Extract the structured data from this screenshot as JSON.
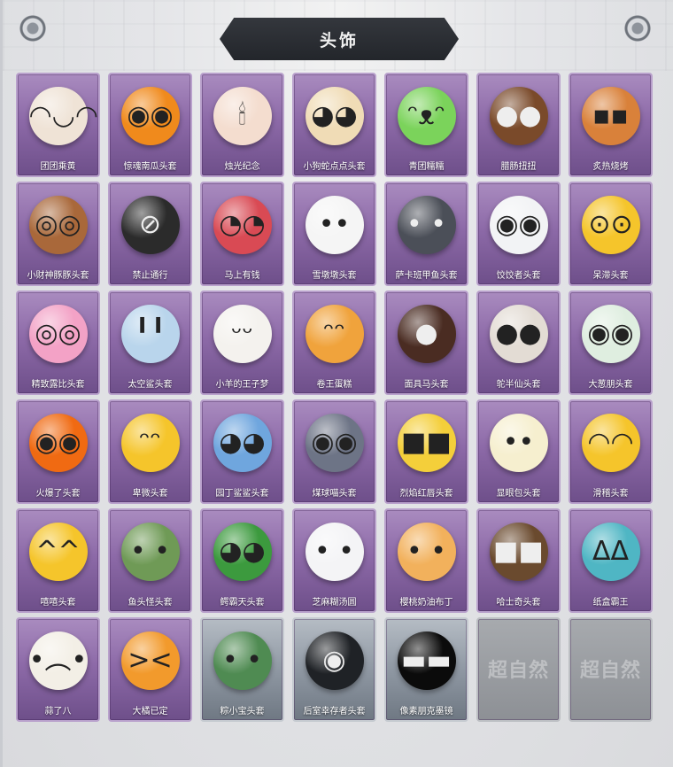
{
  "header": {
    "title": "头饰"
  },
  "items": [
    {
      "label": "团团乘黄",
      "icon": "cream-creature-head-icon",
      "color": "#efe3d6",
      "glyph": "◠◡◠",
      "state": "owned"
    },
    {
      "label": "惊魂南瓜头套",
      "icon": "pumpkin-head-icon",
      "color": "#f08a1c",
      "glyph": "◉◉",
      "state": "owned"
    },
    {
      "label": "烛光纪念",
      "icon": "candle-head-icon",
      "color": "#f4ddcf",
      "glyph": "🕯",
      "state": "owned"
    },
    {
      "label": "小狗蛇点点头套",
      "icon": "snake-head-icon",
      "color": "#f0dcb6",
      "glyph": "◕◕",
      "state": "owned"
    },
    {
      "label": "青团糯糯",
      "icon": "green-rice-ball-icon",
      "color": "#7bd35b",
      "glyph": "ᵔᴥᵔ",
      "state": "owned"
    },
    {
      "label": "腊肠扭扭",
      "icon": "dachshund-head-icon",
      "color": "#7a4a2a",
      "glyph": "●●",
      "state": "owned"
    },
    {
      "label": "炙热烧烤",
      "icon": "grilled-toast-head-icon",
      "color": "#d9813a",
      "glyph": "▪▪",
      "state": "owned"
    },
    {
      "label": "小财神豚豚头套",
      "icon": "capybara-god-head-icon",
      "color": "#a9683a",
      "glyph": "◎◎",
      "state": "owned"
    },
    {
      "label": "禁止通行",
      "icon": "traffic-cone-head-icon",
      "color": "#2b2b2b",
      "glyph": "⊘",
      "state": "owned"
    },
    {
      "label": "马上有钱",
      "icon": "horse-head-icon",
      "color": "#d94a54",
      "glyph": "◔◔",
      "state": "owned"
    },
    {
      "label": "雪墩墩头套",
      "icon": "snowman-head-icon",
      "color": "#f5f5f5",
      "glyph": "••",
      "state": "owned"
    },
    {
      "label": "萨卡班甲鱼头套",
      "icon": "fish-head-icon",
      "color": "#4b4f58",
      "glyph": "• •",
      "state": "owned"
    },
    {
      "label": "饺饺者头套",
      "icon": "dumpling-head-icon",
      "color": "#f2f3f5",
      "glyph": "◉◉",
      "state": "owned"
    },
    {
      "label": "呆滞头套",
      "icon": "dazed-face-icon",
      "color": "#f5c52b",
      "glyph": "⊙⊙",
      "state": "owned"
    },
    {
      "label": "精致露比头套",
      "icon": "pink-beaver-head-icon",
      "color": "#f3a2c6",
      "glyph": "◎◎",
      "state": "owned"
    },
    {
      "label": "太空鲨头套",
      "icon": "space-shark-head-icon",
      "color": "#b9d5ec",
      "glyph": "╹╹",
      "state": "owned"
    },
    {
      "label": "小羊的王子梦",
      "icon": "sheep-crown-head-icon",
      "color": "#f4f2ee",
      "glyph": "ᵕᵕ",
      "state": "owned"
    },
    {
      "label": "卷王蛋糕",
      "icon": "swiss-roll-head-icon",
      "color": "#f0a33c",
      "glyph": "ᵔᵔ",
      "state": "owned"
    },
    {
      "label": "面具马头套",
      "icon": "horse-mask-icon",
      "color": "#4a2c22",
      "glyph": "●",
      "state": "owned"
    },
    {
      "label": "鸵半仙头套",
      "icon": "cat-sunglasses-head-icon",
      "color": "#e3dcd4",
      "glyph": "●●",
      "state": "owned"
    },
    {
      "label": "大葱朋头套",
      "icon": "green-onion-head-icon",
      "color": "#dfeee0",
      "glyph": "◉◉",
      "state": "owned"
    },
    {
      "label": "火爆了头套",
      "icon": "fire-head-icon",
      "color": "#f06a12",
      "glyph": "◉◉",
      "state": "owned"
    },
    {
      "label": "卑微头套",
      "icon": "humble-face-icon",
      "color": "#f5c52b",
      "glyph": "ᵔᵔ",
      "state": "owned"
    },
    {
      "label": "园丁鲨鲨头套",
      "icon": "blue-shark-head-icon",
      "color": "#6fa6de",
      "glyph": "◕◕",
      "state": "owned"
    },
    {
      "label": "煤球喵头套",
      "icon": "gray-cat-head-icon",
      "color": "#6d7486",
      "glyph": "◉◉",
      "state": "owned"
    },
    {
      "label": "烈焰红唇头套",
      "icon": "pikachu-head-icon",
      "color": "#f4cf3a",
      "glyph": "■■",
      "state": "owned"
    },
    {
      "label": "显眼包头套",
      "icon": "lightbulb-head-icon",
      "color": "#f6efcf",
      "glyph": "••",
      "state": "owned"
    },
    {
      "label": "滑稽头套",
      "icon": "funny-face-icon",
      "color": "#f5c52b",
      "glyph": "◠◠",
      "state": "owned"
    },
    {
      "label": "嘻嘻头套",
      "icon": "grin-face-icon",
      "color": "#f5c52b",
      "glyph": "^^",
      "state": "owned"
    },
    {
      "label": "鱼头怪头套",
      "icon": "fish-man-head-icon",
      "color": "#6f9a56",
      "glyph": "• •",
      "state": "owned"
    },
    {
      "label": "鳄霸天头套",
      "icon": "crocodile-head-icon",
      "color": "#3c9a3e",
      "glyph": "◕◕",
      "state": "owned"
    },
    {
      "label": "芝麻糊汤圆",
      "icon": "rice-ball-flower-icon",
      "color": "#f4f4f6",
      "glyph": "• •",
      "state": "owned"
    },
    {
      "label": "樱桃奶油布丁",
      "icon": "pudding-head-icon",
      "color": "#f2b15c",
      "glyph": "• •",
      "state": "owned"
    },
    {
      "label": "哈士奇头套",
      "icon": "husky-head-icon",
      "color": "#6a4a2e",
      "glyph": "■■",
      "state": "owned"
    },
    {
      "label": "纸盒霸王",
      "icon": "cardboard-dino-head-icon",
      "color": "#4fb6c4",
      "glyph": "ᐃᐃ",
      "state": "owned"
    },
    {
      "label": "蒜了八",
      "icon": "garlic-head-icon",
      "color": "#f3efe6",
      "glyph": "•︵•",
      "state": "owned"
    },
    {
      "label": "大橘已定",
      "icon": "orange-slice-head-icon",
      "color": "#f29a2c",
      "glyph": "><",
      "state": "owned"
    },
    {
      "label": "粽小宝头套",
      "icon": "zongzi-head-icon",
      "color": "#4f8b52",
      "glyph": "• •",
      "state": "rare"
    },
    {
      "label": "后室幸存者头套",
      "icon": "gas-mask-helmet-icon",
      "color": "#1f2226",
      "glyph": "◉",
      "state": "rare"
    },
    {
      "label": "像素朋克墨镜",
      "icon": "pixel-sunglasses-icon",
      "color": "#0b0b0b",
      "glyph": "▬▬",
      "state": "rare"
    },
    {
      "label": "超自然",
      "icon": "locked-slot-icon",
      "color": "#9a9da2",
      "glyph": "",
      "state": "locked"
    },
    {
      "label": "超自然",
      "icon": "locked-slot-icon",
      "color": "#9a9da2",
      "glyph": "",
      "state": "locked"
    }
  ]
}
